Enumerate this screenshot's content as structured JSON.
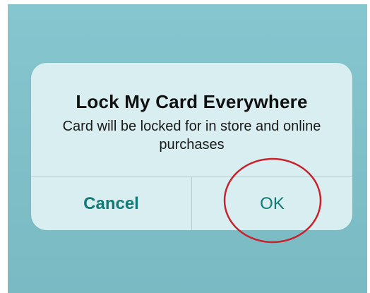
{
  "alert": {
    "title": "Lock My Card Everywhere",
    "message": "Card will be locked for in store and online purchases",
    "cancel_label": "Cancel",
    "ok_label": "OK"
  },
  "colors": {
    "backdrop": "#82c2cb",
    "alert_background": "#d9eef0",
    "button_text": "#127a76",
    "annotation": "#c8232c"
  }
}
